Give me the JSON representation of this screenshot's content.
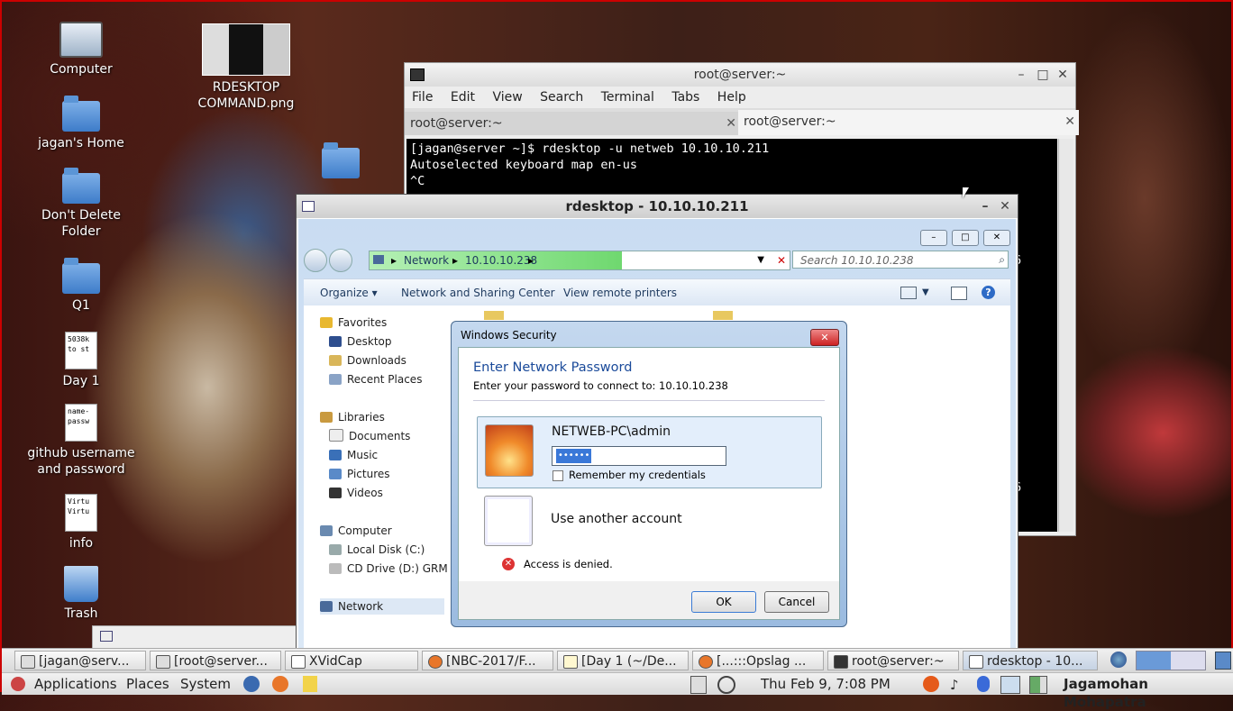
{
  "desktop": {
    "icons": [
      {
        "label": "Computer"
      },
      {
        "label": "RDESKTOP COMMAND.png"
      },
      {
        "label": "jagan's Home"
      },
      {
        "label": "Don't Delete Folder"
      },
      {
        "label": "Q1"
      },
      {
        "label": "Day 1",
        "preview": "5038k\nto st"
      },
      {
        "label": "github username and password",
        "preview": "name-\npassw"
      },
      {
        "label": "info",
        "preview": "Virtu\nVirtu"
      },
      {
        "label": "Trash"
      }
    ]
  },
  "terminal": {
    "title": "root@server:~",
    "menu": [
      "File",
      "Edit",
      "View",
      "Search",
      "Terminal",
      "Tabs",
      "Help"
    ],
    "tabs": [
      "root@server:~",
      "root@server:~"
    ],
    "lines": [
      "[jagan@server ~]$ rdesktop -u netweb 10.10.10.211",
      "Autoselected keyboard map en-us",
      "^C"
    ],
    "edge_fragments": [
      "6",
      "6"
    ]
  },
  "rdesktop": {
    "title": "rdesktop - 10.10.10.211",
    "address": {
      "segments": [
        "Network",
        "10.10.10.238"
      ]
    },
    "search_placeholder": "Search 10.10.10.238",
    "commands": [
      "Organize",
      "Network and Sharing Center",
      "View remote printers"
    ],
    "nav": {
      "favorites": "Favorites",
      "favorites_items": [
        "Desktop",
        "Downloads",
        "Recent Places"
      ],
      "libraries": "Libraries",
      "libraries_items": [
        "Documents",
        "Music",
        "Pictures",
        "Videos"
      ],
      "computer": "Computer",
      "computer_items": [
        "Local Disk (C:)",
        "CD Drive (D:) GRMC"
      ],
      "network": "Network"
    }
  },
  "dialog": {
    "title": "Windows Security",
    "heading": "Enter Network Password",
    "subtitle": "Enter your password to connect to: 10.10.10.238",
    "username": "NETWEB-PC\\admin",
    "password_mask": "••••••",
    "remember": "Remember my credentials",
    "other_account": "Use another account",
    "error": "Access is denied.",
    "ok": "OK",
    "cancel": "Cancel"
  },
  "taskbar": {
    "items": [
      "[jagan@serv...",
      "[root@server...",
      "XVidCap",
      "[NBC-2017/F...",
      "[Day 1 (~/De...",
      "[...:::Opslag ...",
      "root@server:~",
      "rdesktop - 10..."
    ]
  },
  "panel": {
    "menus": [
      "Applications",
      "Places",
      "System"
    ],
    "clock": "Thu Feb  9,  7:08 PM",
    "user": "Jagamohan Mohapatra"
  }
}
